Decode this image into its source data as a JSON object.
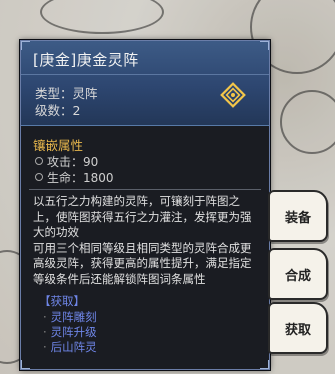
{
  "item": {
    "title": "[庚金]庚金灵阵",
    "type_line": "类型：灵阵",
    "level_line": "级数：2",
    "icon": "diamond-rune-icon",
    "accent_color": "#e6b64c"
  },
  "attributes": {
    "section_title": "镶嵌属性",
    "lines": [
      "攻击：90",
      "生命：1800"
    ]
  },
  "description": {
    "para1": "以五行之力构建的灵阵，可镶刻于阵图之上，使阵图获得五行之力灌注，发挥更为强大的功效",
    "para2": "可用三个相同等级且相同类型的灵阵合成更高级灵阵，获得更高的属性提升，满足指定等级条件后还能解锁阵图词条属性"
  },
  "obtain": {
    "title": "【获取】",
    "items": [
      "灵阵雕刻",
      "灵阵升级",
      "后山阵灵"
    ],
    "color": "#6f86e8"
  },
  "buttons": {
    "equip": "装备",
    "combine": "合成",
    "obtain": "获取"
  }
}
